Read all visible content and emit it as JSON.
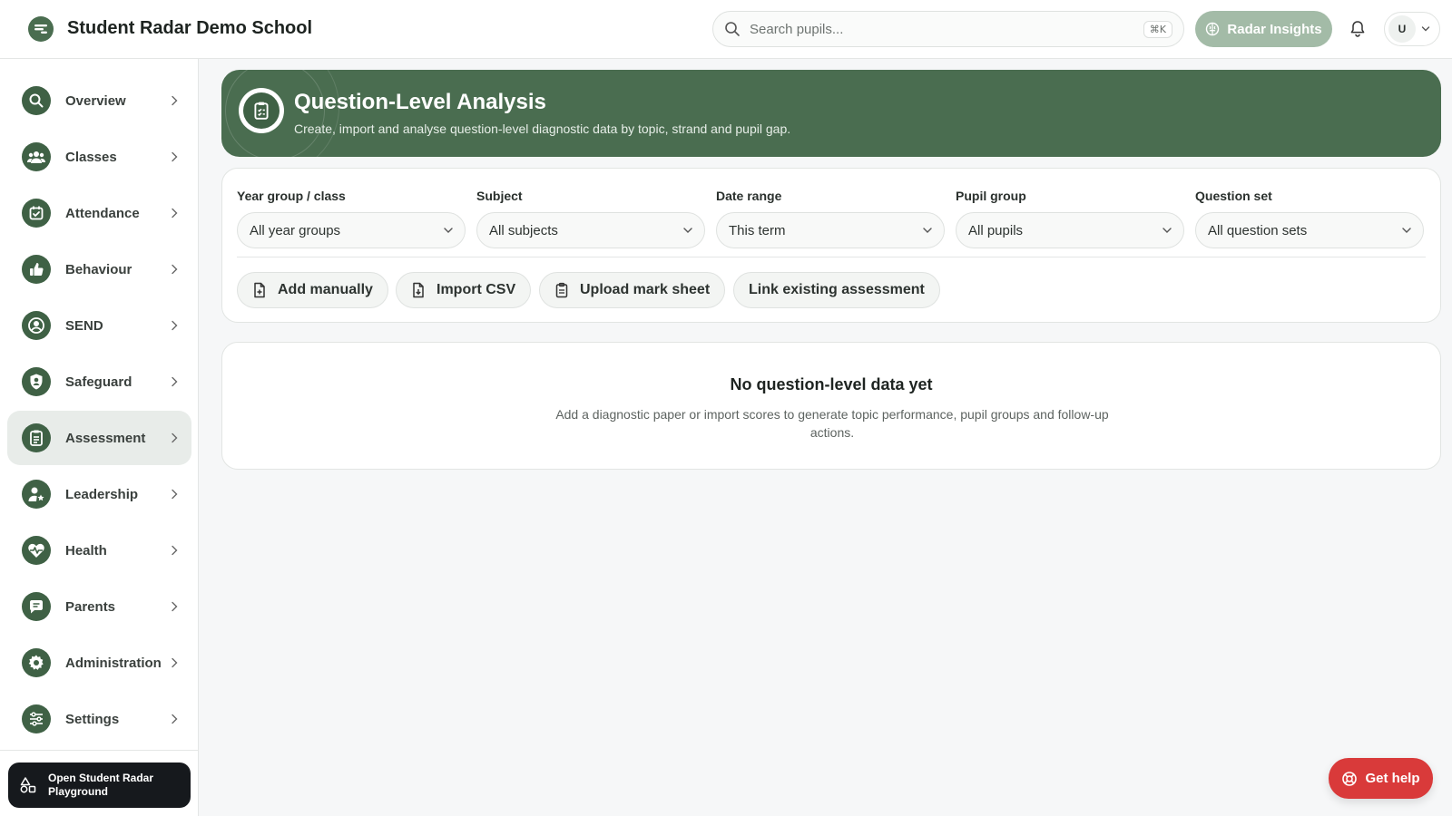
{
  "header": {
    "school_name": "Student Radar Demo School",
    "search_placeholder": "Search pupils...",
    "search_shortcut": "⌘K",
    "insights_label": "Radar Insights",
    "user_initial": "U"
  },
  "sidebar": {
    "items": [
      {
        "label": "Overview",
        "icon": "search-icon"
      },
      {
        "label": "Classes",
        "icon": "users-icon"
      },
      {
        "label": "Attendance",
        "icon": "calendar-check-icon"
      },
      {
        "label": "Behaviour",
        "icon": "thumbs-up-icon"
      },
      {
        "label": "SEND",
        "icon": "user-circle-icon"
      },
      {
        "label": "Safeguard",
        "icon": "shield-user-icon"
      },
      {
        "label": "Assessment",
        "icon": "clipboard-list-icon",
        "active": true
      },
      {
        "label": "Leadership",
        "icon": "user-star-icon"
      },
      {
        "label": "Health",
        "icon": "heart-pulse-icon"
      },
      {
        "label": "Parents",
        "icon": "message-icon"
      },
      {
        "label": "Administration",
        "icon": "gear-icon"
      },
      {
        "label": "Settings",
        "icon": "sliders-icon"
      }
    ],
    "playground_label": "Open Student Radar Playground"
  },
  "hero": {
    "title": "Question-Level Analysis",
    "subtitle": "Create, import and analyse question-level diagnostic data by topic, strand and pupil gap."
  },
  "filters": [
    {
      "label": "Year group / class",
      "value": "All year groups"
    },
    {
      "label": "Subject",
      "value": "All subjects"
    },
    {
      "label": "Date range",
      "value": "This term"
    },
    {
      "label": "Pupil group",
      "value": "All pupils"
    },
    {
      "label": "Question set",
      "value": "All question sets"
    }
  ],
  "actions": {
    "add_manually": "Add manually",
    "import_csv": "Import CSV",
    "upload_mark_sheet": "Upload mark sheet",
    "link_existing": "Link existing assessment"
  },
  "empty_state": {
    "title": "No question-level data yet",
    "text": "Add a diagnostic paper or import scores to generate topic performance, pupil groups and follow-up actions."
  },
  "help": {
    "label": "Get help"
  },
  "colors": {
    "brand": "#4a6d50",
    "brand_dark": "#3f6145",
    "insights": "#a3bba7",
    "help": "#d93a3a",
    "playground": "#16191d"
  }
}
